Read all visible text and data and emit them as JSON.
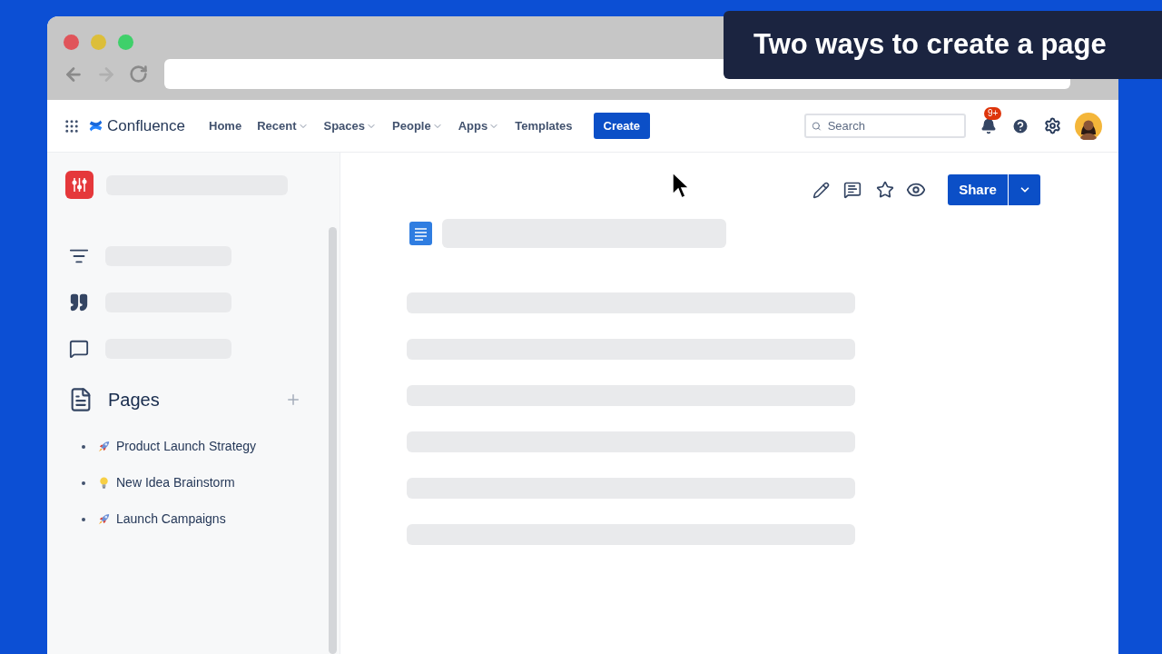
{
  "caption": "Two ways to create a page",
  "nav": {
    "product": "Confluence",
    "items": [
      {
        "label": "Home",
        "has_menu": false
      },
      {
        "label": "Recent",
        "has_menu": true
      },
      {
        "label": "Spaces",
        "has_menu": true
      },
      {
        "label": "People",
        "has_menu": true
      },
      {
        "label": "Apps",
        "has_menu": true
      },
      {
        "label": "Templates",
        "has_menu": false
      }
    ],
    "create_button": "Create",
    "search": {
      "placeholder": "Search"
    },
    "notifications_badge": "9+"
  },
  "sidebar": {
    "pages_heading": "Pages",
    "pages": [
      {
        "title": "Product Launch Strategy",
        "kind": "rocket"
      },
      {
        "title": "New Idea Brainstorm",
        "kind": "idea"
      },
      {
        "title": "Launch Campaigns",
        "kind": "rocket"
      }
    ]
  },
  "page": {
    "share_button": "Share"
  }
}
